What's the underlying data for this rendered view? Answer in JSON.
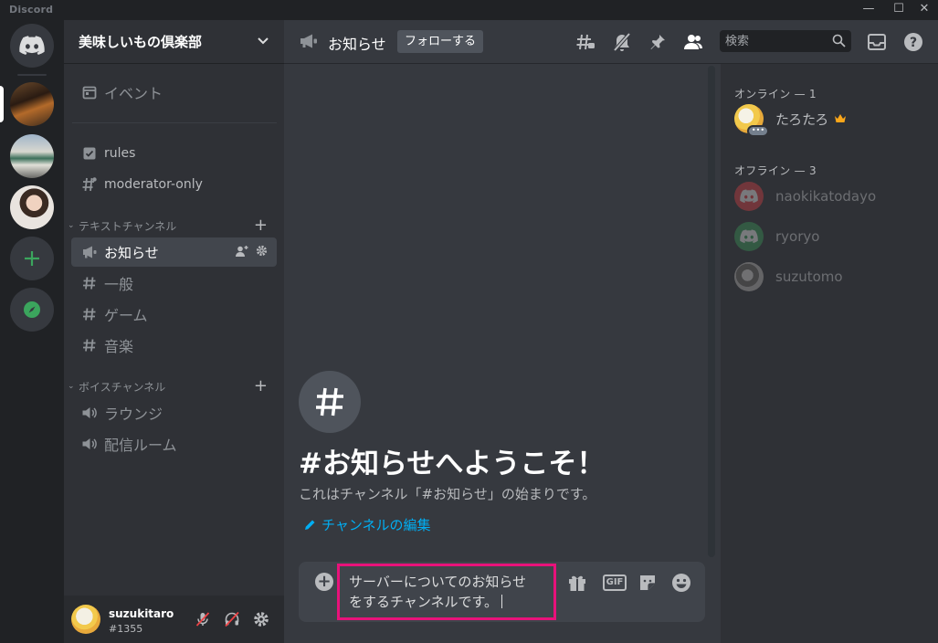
{
  "app": {
    "title": "Discord"
  },
  "window": {
    "minimize": "—",
    "maximize": "☐",
    "close": "✕"
  },
  "guild": {
    "name": "美味しいもの倶楽部"
  },
  "sidebar": {
    "events": "イベント",
    "top_channels": [
      "rules",
      "moderator-only"
    ],
    "text_category": "テキストチャンネル",
    "text_channels": [
      "お知らせ",
      "一般",
      "ゲーム",
      "音楽"
    ],
    "voice_category": "ボイスチャンネル",
    "voice_channels": [
      "ラウンジ",
      "配信ルーム"
    ]
  },
  "user": {
    "name": "suzukitaro",
    "tag": "#1355"
  },
  "channel": {
    "name": "お知らせ",
    "follow_label": "フォローする",
    "search_placeholder": "検索"
  },
  "welcome": {
    "title": "#お知らせへようこそ！",
    "description": "これはチャンネル「#お知らせ」の始まりです。",
    "edit_link": "チャンネルの編集"
  },
  "composer": {
    "line1": "サーバーについてのお知らせ",
    "line2": "をするチャンネルです。",
    "gif_label": "GIF"
  },
  "members": {
    "online_header": "オンライン — 1",
    "online": [
      {
        "name": "たろたろ"
      }
    ],
    "offline_header": "オフライン — 3",
    "offline": [
      {
        "name": "naokikatodayo"
      },
      {
        "name": "ryoryo"
      },
      {
        "name": "suzutomo"
      }
    ]
  },
  "colors": {
    "accent_green": "#3ba55d",
    "link": "#00aff4",
    "highlight_border": "#e8127a",
    "crown": "#faa61a"
  }
}
